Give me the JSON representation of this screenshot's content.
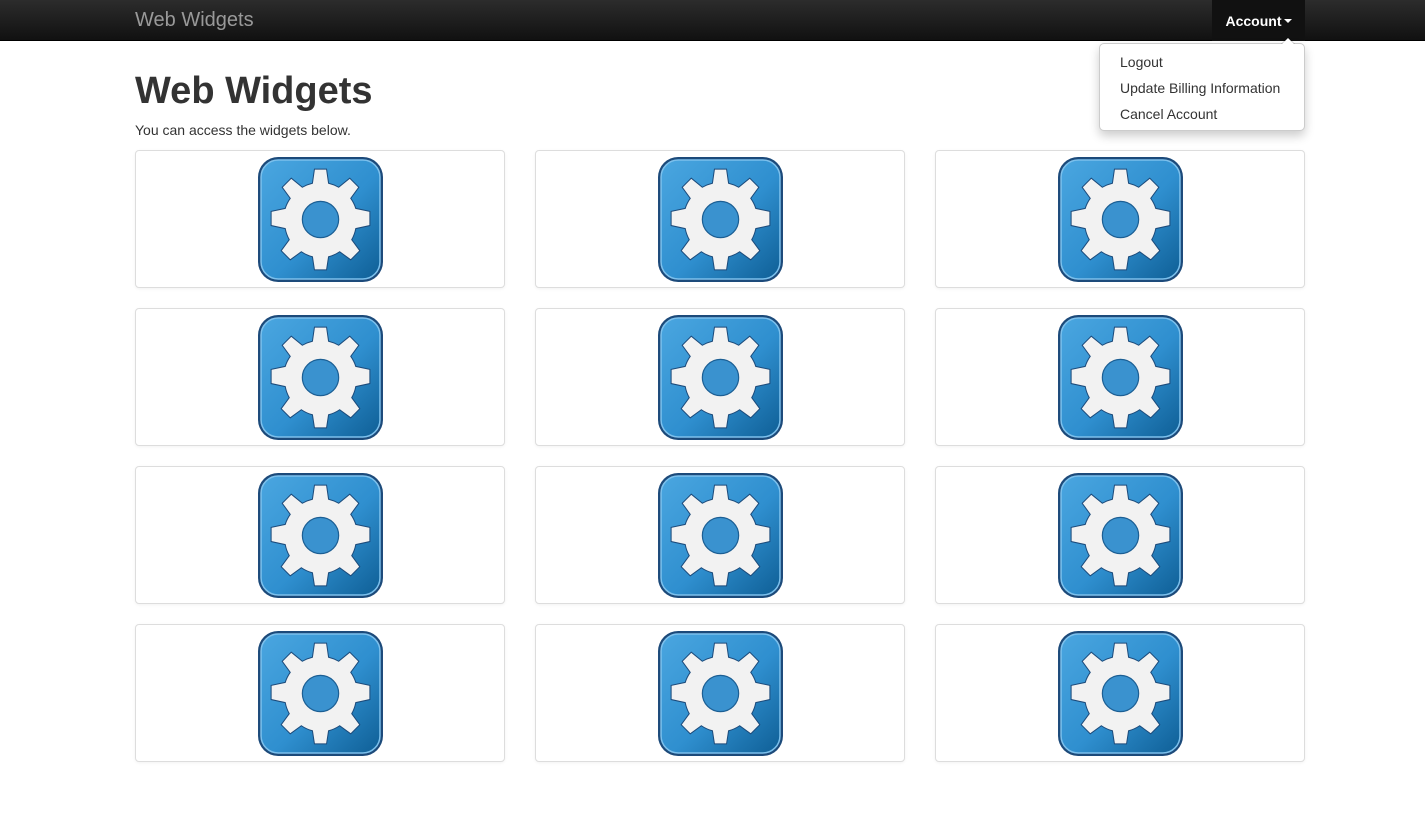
{
  "navbar": {
    "brand": "Web Widgets",
    "account_label": "Account"
  },
  "account_menu": {
    "items": [
      {
        "label": "Logout"
      },
      {
        "label": "Update Billing Information"
      },
      {
        "label": "Cancel Account"
      }
    ]
  },
  "main": {
    "title": "Web Widgets",
    "intro": "You can access the widgets below."
  },
  "widgets": {
    "icon": "gear-icon",
    "count": 12
  },
  "colors": {
    "navbar": "#1b1b1b",
    "icon_blue": "#2f8fcf",
    "icon_border": "#1c4a7a",
    "gear_fill": "#f2f2f2"
  }
}
